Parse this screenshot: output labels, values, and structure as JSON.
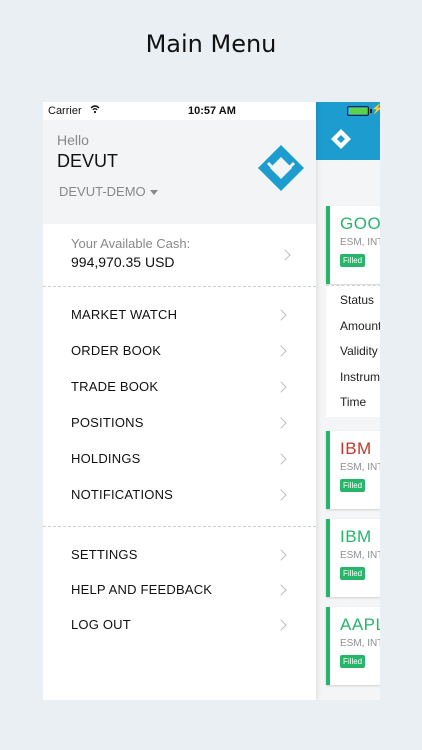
{
  "caption": "Main Menu",
  "statusbar": {
    "carrier": "Carrier",
    "time": "10:57 AM"
  },
  "profile": {
    "greeting": "Hello",
    "username": "DEVUT",
    "account": "DEVUT-DEMO"
  },
  "cash": {
    "label": "Your Available Cash:",
    "value": "994,970.35 USD"
  },
  "menu_primary": [
    {
      "label": "MARKET WATCH"
    },
    {
      "label": "ORDER BOOK"
    },
    {
      "label": "TRADE BOOK"
    },
    {
      "label": "POSITIONS"
    },
    {
      "label": "HOLDINGS"
    },
    {
      "label": "NOTIFICATIONS"
    }
  ],
  "menu_secondary": [
    {
      "label": "SETTINGS"
    },
    {
      "label": "HELP AND FEEDBACK"
    },
    {
      "label": "LOG OUT"
    }
  ],
  "background_orders": [
    {
      "symbol": "GOOG",
      "symbol_color": "#27b56a",
      "exchange": "ESM, INT",
      "status": "Filled"
    },
    {
      "symbol": "IBM",
      "symbol_color": "#c0392b",
      "exchange": "ESM, INT",
      "status": "Filled"
    },
    {
      "symbol": "IBM",
      "symbol_color": "#27b56a",
      "exchange": "ESM, INT",
      "status": "Filled"
    },
    {
      "symbol": "AAPL",
      "symbol_color": "#27b56a",
      "exchange": "ESM, INT",
      "status": "Filled"
    }
  ],
  "order_detail_fields": [
    "Status",
    "Amount",
    "Validity",
    "Instrume",
    "Time"
  ],
  "colors": {
    "brand": "#1d9ccf",
    "filled": "#27b56a",
    "sell": "#c0392b"
  }
}
